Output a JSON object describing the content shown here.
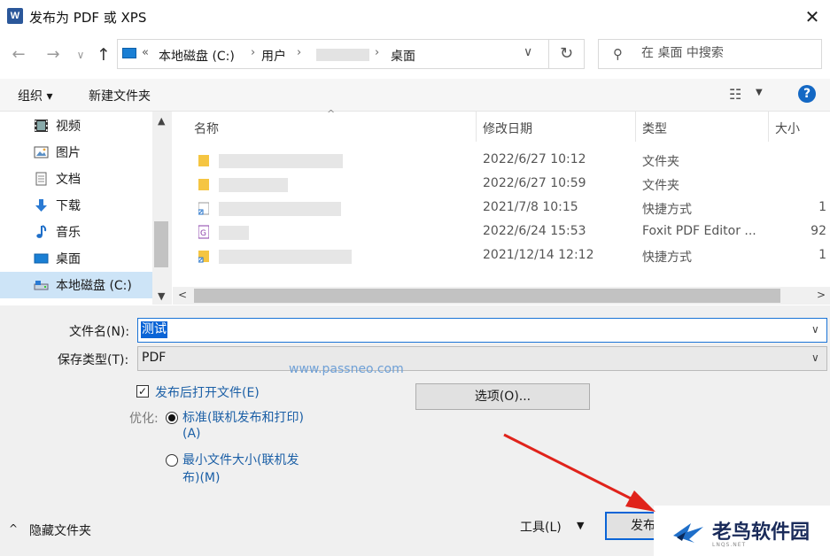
{
  "window": {
    "title": "发布为 PDF 或 XPS",
    "app_icon": "W",
    "close_glyph": "✕"
  },
  "address": {
    "back_glyph": "←",
    "forward_glyph": "→",
    "recent_glyph": "∨",
    "up_glyph": "↑",
    "double_chevron": "«",
    "crumbs": [
      "本地磁盘 (C:)",
      "用户",
      "桌面"
    ],
    "sep": "›",
    "dropdown_glyph": "∨",
    "refresh_glyph": "↻"
  },
  "search": {
    "placeholder": "在 桌面 中搜索",
    "icon": "⚲"
  },
  "toolbar": {
    "organize": "组织 ▾",
    "new_folder": "新建文件夹",
    "view_icon": "☷",
    "view_chev": "▼",
    "help": "?"
  },
  "nav": {
    "items": [
      {
        "label": "视频",
        "icon": "film-icon"
      },
      {
        "label": "图片",
        "icon": "picture-icon"
      },
      {
        "label": "文档",
        "icon": "document-icon"
      },
      {
        "label": "下载",
        "icon": "download-icon"
      },
      {
        "label": "音乐",
        "icon": "music-icon"
      },
      {
        "label": "桌面",
        "icon": "desktop-icon"
      },
      {
        "label": "本地磁盘 (C:)",
        "icon": "drive-icon",
        "selected": true
      }
    ],
    "scroll_up": "▲",
    "scroll_down": "▼"
  },
  "files": {
    "columns": {
      "name": "名称",
      "date": "修改日期",
      "type": "类型",
      "size": "大小"
    },
    "sort_caret": "^",
    "rows": [
      {
        "date": "2022/6/27 10:12",
        "type": "文件夹",
        "size": "",
        "icon": "folder-icon"
      },
      {
        "date": "2022/6/27 10:59",
        "type": "文件夹",
        "size": "",
        "icon": "folder-icon"
      },
      {
        "date": "2021/7/8 10:15",
        "type": "快捷方式",
        "size": "1",
        "icon": "shortcut-icon"
      },
      {
        "date": "2022/6/24 15:53",
        "type": "Foxit PDF Editor ...",
        "size": "92",
        "icon": "pdf-icon"
      },
      {
        "date": "2021/12/14 12:12",
        "type": "快捷方式",
        "size": "1",
        "icon": "shortcut-icon"
      }
    ],
    "hscroll_left": "<",
    "hscroll_right": ">"
  },
  "form": {
    "filename_label": "文件名(N):",
    "filename_value": "测试",
    "chev": "∨",
    "type_label": "保存类型(T):",
    "type_value": "PDF",
    "watermark": "www.passneo.com",
    "open_after_label": "发布后打开文件(E)",
    "open_after_checked": true,
    "check_glyph": "✓",
    "optimize_label": "优化:",
    "std_label_1": "标准(联机发布和打印)",
    "std_label_2": "(A)",
    "min_label_1": "最小文件大小(联机发",
    "min_label_2": "布)(M)",
    "options_button": "选项(O)..."
  },
  "footer": {
    "hide_caret": "^",
    "hide_folders": "隐藏文件夹",
    "tools": "工具(L)",
    "tools_chev": "▼",
    "publish": "发布"
  },
  "logo": {
    "text": "老鸟软件园",
    "sub": "LNQS.NET"
  },
  "colors": {
    "accent": "#0a64d6",
    "link": "#1b5fa6",
    "arrow": "#e0231b"
  }
}
